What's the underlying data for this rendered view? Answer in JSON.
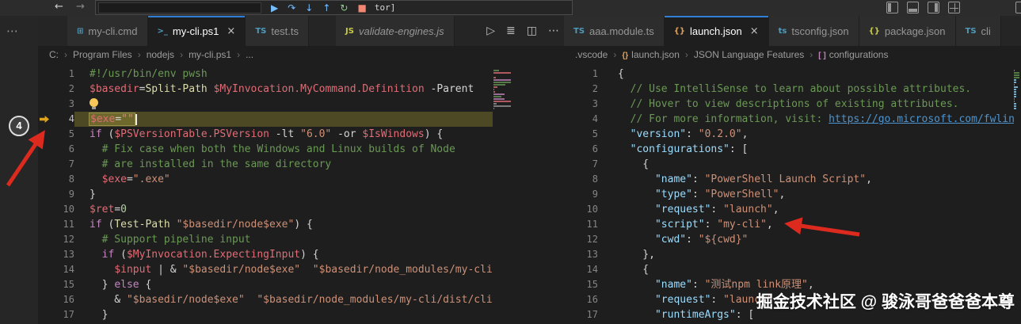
{
  "colors": {
    "accent_tab_border": "#2f7fd6",
    "debug_current_line_glyph": "#e0a41b",
    "debug_line_highlight": "#4d4925",
    "annotation_red": "#dd2a1e",
    "comment": "#6a9955",
    "variable": "#e06c75",
    "string": "#ce9178",
    "keyword": "#c586c0",
    "json_key": "#9cdcfe",
    "link": "#4e94ce"
  },
  "titlebar": {
    "back": "←",
    "forward": "→",
    "debug": {
      "buttons": [
        {
          "name": "continue",
          "glyph": "▶",
          "color": "#75beff"
        },
        {
          "name": "step-over",
          "glyph": "↷",
          "color": "#75beff"
        },
        {
          "name": "step-into",
          "glyph": "↓",
          "color": "#75beff"
        },
        {
          "name": "step-out",
          "glyph": "↑",
          "color": "#75beff"
        },
        {
          "name": "restart",
          "glyph": "↻",
          "color": "#89d185"
        },
        {
          "name": "stop",
          "glyph": "■",
          "color": "#f48771"
        }
      ],
      "session_label": "tor]"
    }
  },
  "left_rail": {
    "menu_glyph": "⋯",
    "annotation_badge": "4"
  },
  "left_group": {
    "tabs": [
      {
        "label": "my-cli.cmd",
        "icon_glyph": "⊞",
        "icon_color": "#519aba",
        "active": false,
        "closable": false
      },
      {
        "label": "my-cli.ps1",
        "icon_glyph": ">_",
        "icon_color": "#519aba",
        "active": true,
        "closable": true
      },
      {
        "label": "test.ts",
        "icon_glyph": "TS",
        "icon_color": "#519aba",
        "active": false,
        "closable": false
      }
    ],
    "preview_tab": {
      "label": "validate-engines.js",
      "icon_glyph": "JS",
      "icon_color": "#cbcb41"
    },
    "actions": [
      {
        "name": "run",
        "glyph": "▷"
      },
      {
        "name": "run-menu",
        "glyph": "≣"
      },
      {
        "name": "split-editor",
        "glyph": "◫"
      },
      {
        "name": "more-actions",
        "glyph": "⋯"
      }
    ],
    "breadcrumb": [
      {
        "label": "C:"
      },
      {
        "label": "Program Files"
      },
      {
        "label": "nodejs"
      },
      {
        "label": "my-cli.ps1"
      },
      {
        "label": "..."
      }
    ],
    "current_line": 4,
    "code": [
      {
        "n": 1,
        "t": [
          [
            "c",
            "#!/usr/bin/env pwsh"
          ]
        ]
      },
      {
        "n": 2,
        "t": [
          [
            "v",
            "$basedir"
          ],
          [
            "o",
            "="
          ],
          [
            "f",
            "Split-Path"
          ],
          [
            "o",
            " "
          ],
          [
            "v",
            "$MyInvocation.MyCommand.Definition"
          ],
          [
            "o",
            " -Parent"
          ]
        ]
      },
      {
        "n": 3,
        "t": []
      },
      {
        "n": 4,
        "hl": true,
        "box": true,
        "t": [
          [
            "v",
            "$exe"
          ],
          [
            "o",
            "="
          ],
          [
            "s",
            "\"\""
          ]
        ]
      },
      {
        "n": 5,
        "t": [
          [
            "k",
            "if"
          ],
          [
            "o",
            " ("
          ],
          [
            "v",
            "$PSVersionTable.PSVersion"
          ],
          [
            "o",
            " -lt "
          ],
          [
            "s",
            "\"6.0\""
          ],
          [
            "o",
            " -or "
          ],
          [
            "v",
            "$IsWindows"
          ],
          [
            "o",
            ") {"
          ]
        ]
      },
      {
        "n": 6,
        "t": [
          [
            "c",
            "  # Fix case when both the Windows and Linux builds of Node"
          ]
        ]
      },
      {
        "n": 7,
        "t": [
          [
            "c",
            "  # are installed in the same directory"
          ]
        ]
      },
      {
        "n": 8,
        "t": [
          [
            "o",
            "  "
          ],
          [
            "v",
            "$exe"
          ],
          [
            "o",
            "="
          ],
          [
            "s",
            "\".exe\""
          ]
        ]
      },
      {
        "n": 9,
        "t": [
          [
            "o",
            "}"
          ]
        ]
      },
      {
        "n": 10,
        "t": [
          [
            "v",
            "$ret"
          ],
          [
            "o",
            "="
          ],
          [
            "n",
            "0"
          ]
        ]
      },
      {
        "n": 11,
        "t": [
          [
            "k",
            "if"
          ],
          [
            "o",
            " ("
          ],
          [
            "f",
            "Test-Path"
          ],
          [
            "o",
            " "
          ],
          [
            "s",
            "\"$basedir/node$exe\""
          ],
          [
            "o",
            ") {"
          ]
        ]
      },
      {
        "n": 12,
        "t": [
          [
            "c",
            "  # Support pipeline input"
          ]
        ]
      },
      {
        "n": 13,
        "t": [
          [
            "o",
            "  "
          ],
          [
            "k",
            "if"
          ],
          [
            "o",
            " ("
          ],
          [
            "v",
            "$MyInvocation.ExpectingInput"
          ],
          [
            "o",
            ") {"
          ]
        ]
      },
      {
        "n": 14,
        "t": [
          [
            "o",
            "    "
          ],
          [
            "v",
            "$input"
          ],
          [
            "o",
            " | & "
          ],
          [
            "s",
            "\"$basedir/node$exe\""
          ],
          [
            "o",
            "  "
          ],
          [
            "s",
            "\"$basedir/node_modules/my-cli/d"
          ]
        ]
      },
      {
        "n": 15,
        "t": [
          [
            "o",
            "  } "
          ],
          [
            "k",
            "else"
          ],
          [
            "o",
            " {"
          ]
        ]
      },
      {
        "n": 16,
        "t": [
          [
            "o",
            "    & "
          ],
          [
            "s",
            "\"$basedir/node$exe\""
          ],
          [
            "o",
            "  "
          ],
          [
            "s",
            "\"$basedir/node_modules/my-cli/dist/cli."
          ]
        ]
      },
      {
        "n": 17,
        "t": [
          [
            "o",
            "  }"
          ]
        ]
      }
    ]
  },
  "right_group": {
    "tabs": [
      {
        "label": "aaa.module.ts",
        "icon_glyph": "TS",
        "icon_color": "#519aba",
        "active": false,
        "closable": false
      },
      {
        "label": "launch.json",
        "icon_glyph": "{}",
        "icon_color": "#e2a259",
        "active": true,
        "closable": true
      },
      {
        "label": "tsconfig.json",
        "icon_glyph": "ts",
        "icon_color": "#519aba",
        "active": false,
        "closable": false
      },
      {
        "label": "package.json",
        "icon_glyph": "{}",
        "icon_color": "#cbcb41",
        "active": false,
        "closable": false
      },
      {
        "label": "cli",
        "icon_glyph": "TS",
        "icon_color": "#519aba",
        "active": false,
        "closable": false
      }
    ],
    "breadcrumb": [
      {
        "label": ".vscode"
      },
      {
        "label": "launch.json",
        "icon": "{}",
        "icon_color": "#e2a259"
      },
      {
        "label": "JSON Language Features"
      },
      {
        "label": "configurations",
        "icon": "[ ]",
        "icon_color": "#c586c0"
      }
    ],
    "code": [
      {
        "n": 1,
        "t": [
          [
            "o",
            "{"
          ]
        ]
      },
      {
        "n": 2,
        "t": [
          [
            "c",
            "  // Use IntelliSense to learn about possible attributes."
          ]
        ]
      },
      {
        "n": 3,
        "t": [
          [
            "c",
            "  // Hover to view descriptions of existing attributes."
          ]
        ]
      },
      {
        "n": 4,
        "t": [
          [
            "c",
            "  // For more information, visit: "
          ],
          [
            "u",
            "https://go.microsoft.com/fwlin"
          ]
        ]
      },
      {
        "n": 5,
        "t": [
          [
            "o",
            "  "
          ],
          [
            "key",
            "\"version\""
          ],
          [
            "o",
            ": "
          ],
          [
            "s",
            "\"0.2.0\""
          ],
          [
            "o",
            ","
          ]
        ]
      },
      {
        "n": 6,
        "t": [
          [
            "o",
            "  "
          ],
          [
            "key",
            "\"configurations\""
          ],
          [
            "o",
            ": ["
          ]
        ]
      },
      {
        "n": 7,
        "t": [
          [
            "o",
            "    {"
          ]
        ]
      },
      {
        "n": 8,
        "t": [
          [
            "o",
            "      "
          ],
          [
            "key",
            "\"name\""
          ],
          [
            "o",
            ": "
          ],
          [
            "s",
            "\"PowerShell Launch Script\""
          ],
          [
            "o",
            ","
          ]
        ]
      },
      {
        "n": 9,
        "t": [
          [
            "o",
            "      "
          ],
          [
            "key",
            "\"type\""
          ],
          [
            "o",
            ": "
          ],
          [
            "s",
            "\"PowerShell\""
          ],
          [
            "o",
            ","
          ]
        ]
      },
      {
        "n": 10,
        "t": [
          [
            "o",
            "      "
          ],
          [
            "key",
            "\"request\""
          ],
          [
            "o",
            ": "
          ],
          [
            "s",
            "\"launch\""
          ],
          [
            "o",
            ","
          ]
        ]
      },
      {
        "n": 11,
        "t": [
          [
            "o",
            "      "
          ],
          [
            "key",
            "\"script\""
          ],
          [
            "o",
            ": "
          ],
          [
            "s",
            "\"my-cli\""
          ],
          [
            "o",
            ","
          ]
        ]
      },
      {
        "n": 12,
        "t": [
          [
            "o",
            "      "
          ],
          [
            "key",
            "\"cwd\""
          ],
          [
            "o",
            ": "
          ],
          [
            "s",
            "\"${cwd}\""
          ]
        ]
      },
      {
        "n": 13,
        "t": [
          [
            "o",
            "    },"
          ]
        ]
      },
      {
        "n": 14,
        "t": [
          [
            "o",
            "    {"
          ]
        ]
      },
      {
        "n": 15,
        "t": [
          [
            "o",
            "      "
          ],
          [
            "key",
            "\"name\""
          ],
          [
            "o",
            ": "
          ],
          [
            "s",
            "\"测试npm link原理\""
          ],
          [
            "o",
            ","
          ]
        ]
      },
      {
        "n": 16,
        "t": [
          [
            "o",
            "      "
          ],
          [
            "key",
            "\"request\""
          ],
          [
            "o",
            ": "
          ],
          [
            "s",
            "\"launch\""
          ],
          [
            "o",
            ","
          ]
        ]
      },
      {
        "n": 17,
        "t": [
          [
            "o",
            "      "
          ],
          [
            "key",
            "\"runtimeArgs\""
          ],
          [
            "o",
            ": ["
          ]
        ]
      }
    ]
  },
  "annotations": {
    "watermark": "掘金技术社区 @ 骏泳哥爸爸爸本尊"
  }
}
